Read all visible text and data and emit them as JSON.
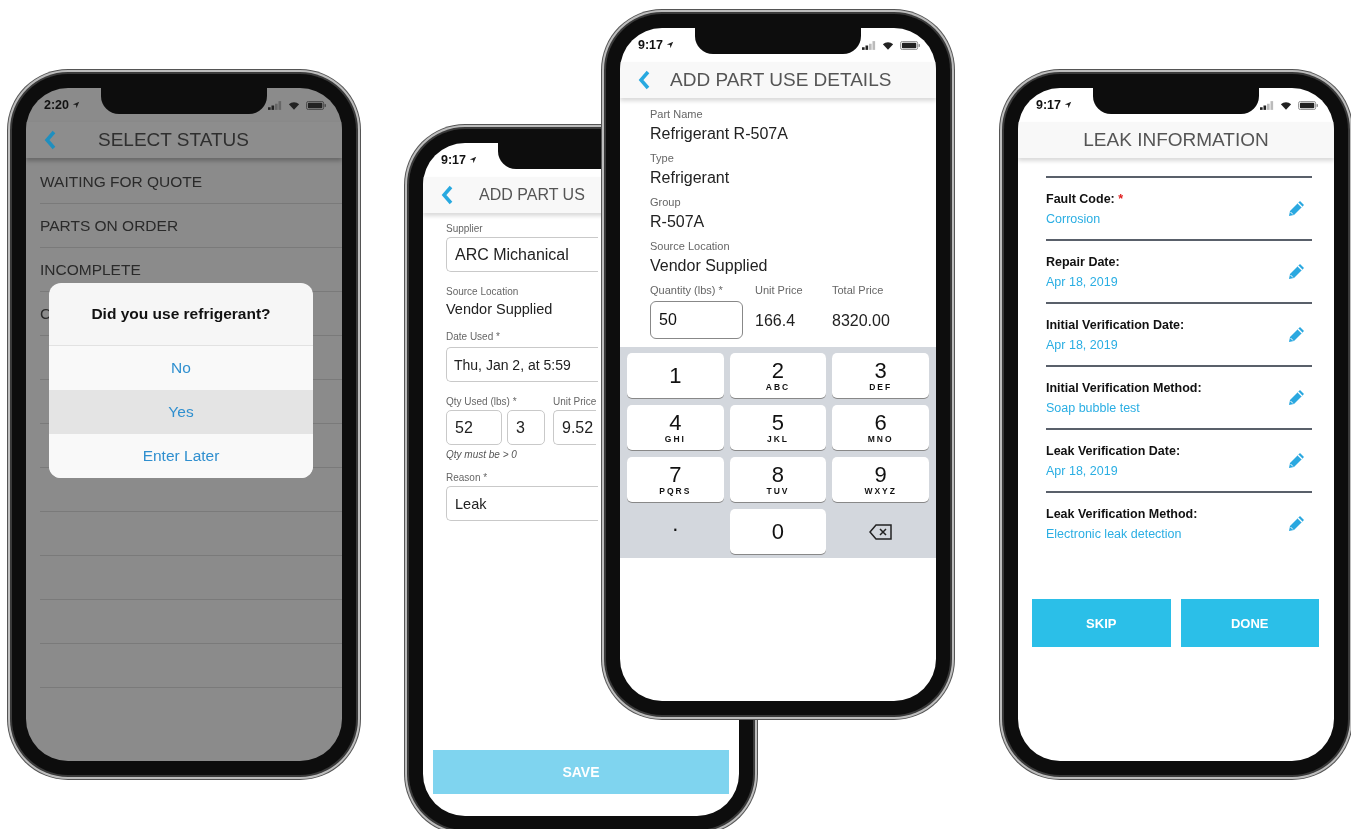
{
  "status_screen": {
    "time": "2:20",
    "title": "SELECT STATUS",
    "items": [
      "WAITING FOR QUOTE",
      "PARTS ON ORDER",
      "INCOMPLETE",
      "C"
    ],
    "dialog": {
      "title": "Did you use refrigerant?",
      "options": [
        {
          "label": "No",
          "selected": false
        },
        {
          "label": "Yes",
          "selected": true
        },
        {
          "label": "Enter Later",
          "selected": false
        }
      ]
    }
  },
  "part_use_form": {
    "time": "9:17",
    "title": "ADD PART US",
    "supplier": {
      "label": "Supplier",
      "value": "ARC Michanical"
    },
    "source_location": {
      "label": "Source Location",
      "value": "Vendor Supplied"
    },
    "date_used": {
      "label": "Date Used *",
      "value": "Thu, Jan 2, at 5:59"
    },
    "qty_used": {
      "label": "Qty Used (lbs) *",
      "values": [
        "52",
        "3"
      ]
    },
    "unit_price": {
      "label": "Unit Price",
      "value": "9.52"
    },
    "hint": "Qty must be > 0",
    "reason": {
      "label": "Reason *",
      "value": "Leak"
    },
    "save_button": {
      "label": "SAVE",
      "disabled": true
    }
  },
  "part_details": {
    "time": "9:17",
    "title": "ADD PART USE DETAILS",
    "fields": [
      {
        "label": "Part Name",
        "value": "Refrigerant R-507A"
      },
      {
        "label": "Type",
        "value": "Refrigerant"
      },
      {
        "label": "Group",
        "value": "R-507A"
      },
      {
        "label": "Source Location",
        "value": "Vendor Supplied"
      }
    ],
    "quantity": {
      "label": "Quantity (lbs) *",
      "value": "50"
    },
    "unit_price": {
      "label": "Unit Price",
      "value": "166.4"
    },
    "total_price": {
      "label": "Total Price",
      "value": "8320.00"
    },
    "keys": [
      {
        "kind": "key",
        "digit": "1"
      },
      {
        "kind": "key",
        "digit": "2",
        "letters": "ABC"
      },
      {
        "kind": "key",
        "digit": "3",
        "letters": "DEF"
      },
      {
        "kind": "key",
        "digit": "4",
        "letters": "GHI"
      },
      {
        "kind": "key",
        "digit": "5",
        "letters": "JKL"
      },
      {
        "kind": "key",
        "digit": "6",
        "letters": "MNO"
      },
      {
        "kind": "key",
        "digit": "7",
        "letters": "PQRS"
      },
      {
        "kind": "key",
        "digit": "8",
        "letters": "TUV"
      },
      {
        "kind": "key",
        "digit": "9",
        "letters": "WXYZ"
      },
      {
        "kind": "symbol",
        "digit": "."
      },
      {
        "kind": "key",
        "digit": "0"
      },
      {
        "kind": "backspace"
      }
    ]
  },
  "leak_info": {
    "time": "9:17",
    "title": "LEAK INFORMATION",
    "fields": [
      {
        "label": "Fault Code:",
        "required_mark": "*",
        "value": "Corrosion"
      },
      {
        "label": "Repair Date:",
        "value": "Apr 18, 2019"
      },
      {
        "label": "Initial Verification Date:",
        "value": "Apr 18, 2019"
      },
      {
        "label": "Initial Verification Method:",
        "value": "Soap bubble test"
      },
      {
        "label": "Leak Verification Date:",
        "value": "Apr 18, 2019"
      },
      {
        "label": "Leak Verification Method:",
        "value": "Electronic leak detection"
      }
    ],
    "buttons": [
      "SKIP",
      "DONE"
    ]
  }
}
